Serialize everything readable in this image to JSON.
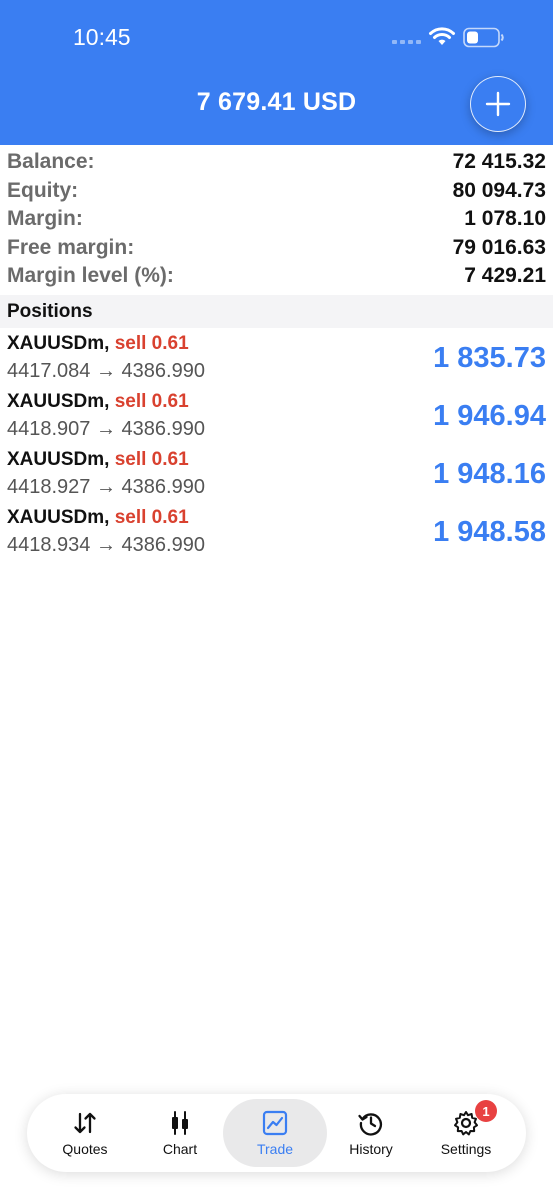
{
  "status_bar": {
    "time": "10:45"
  },
  "header": {
    "balance_title": "7 679.41 USD"
  },
  "summary": [
    {
      "label": "Balance:",
      "value": "72 415.32"
    },
    {
      "label": "Equity:",
      "value": "80 094.73"
    },
    {
      "label": "Margin:",
      "value": "1 078.10"
    },
    {
      "label": "Free margin:",
      "value": "79 016.63"
    },
    {
      "label": "Margin level (%):",
      "value": "7 429.21"
    }
  ],
  "positions_header": "Positions",
  "positions": [
    {
      "symbol": "XAUUSDm,",
      "side": "sell 0.61",
      "prices": "4417.084 → 4386.990",
      "profit": "1 835.73"
    },
    {
      "symbol": "XAUUSDm,",
      "side": "sell 0.61",
      "prices": "4418.907 → 4386.990",
      "profit": "1 946.94"
    },
    {
      "symbol": "XAUUSDm,",
      "side": "sell 0.61",
      "prices": "4418.927 → 4386.990",
      "profit": "1 948.16"
    },
    {
      "symbol": "XAUUSDm,",
      "side": "sell 0.61",
      "prices": "4418.934 → 4386.990",
      "profit": "1 948.58"
    }
  ],
  "tabs": [
    {
      "label": "Quotes",
      "icon": "quotes-icon"
    },
    {
      "label": "Chart",
      "icon": "chart-icon"
    },
    {
      "label": "Trade",
      "icon": "trade-icon",
      "active": true
    },
    {
      "label": "History",
      "icon": "history-icon"
    },
    {
      "label": "Settings",
      "icon": "settings-icon",
      "badge": "1"
    }
  ],
  "colors": {
    "accent": "#3a7ef2",
    "sell": "#d9412f",
    "badge": "#e84141"
  }
}
